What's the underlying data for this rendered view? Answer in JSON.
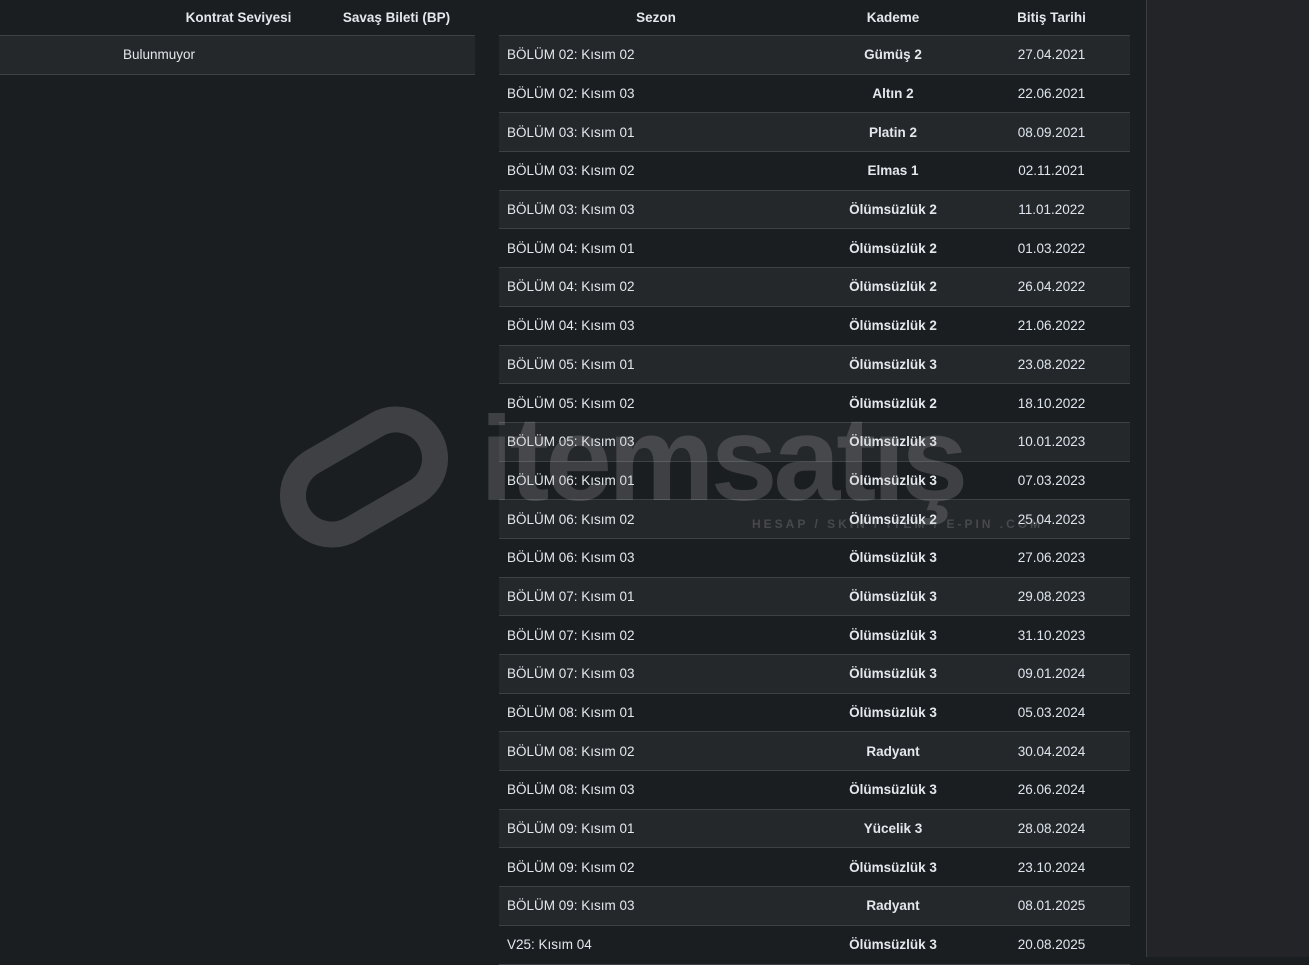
{
  "left_table": {
    "headers": [
      "",
      "Kontrat Seviyesi",
      "Savaş Bileti (BP)"
    ],
    "row": {
      "value": "Bulunmuyor"
    }
  },
  "right_table": {
    "headers": [
      "Sezon",
      "Kademe",
      "Bitiş Tarihi"
    ],
    "rows": [
      [
        "BÖLÜM 02: Kısım 02",
        "Gümüş 2",
        "27.04.2021"
      ],
      [
        "BÖLÜM 02: Kısım 03",
        "Altın 2",
        "22.06.2021"
      ],
      [
        "BÖLÜM 03: Kısım 01",
        "Platin 2",
        "08.09.2021"
      ],
      [
        "BÖLÜM 03: Kısım 02",
        "Elmas 1",
        "02.11.2021"
      ],
      [
        "BÖLÜM 03: Kısım 03",
        "Ölümsüzlük 2",
        "11.01.2022"
      ],
      [
        "BÖLÜM 04: Kısım 01",
        "Ölümsüzlük 2",
        "01.03.2022"
      ],
      [
        "BÖLÜM 04: Kısım 02",
        "Ölümsüzlük 2",
        "26.04.2022"
      ],
      [
        "BÖLÜM 04: Kısım 03",
        "Ölümsüzlük 2",
        "21.06.2022"
      ],
      [
        "BÖLÜM 05: Kısım 01",
        "Ölümsüzlük 3",
        "23.08.2022"
      ],
      [
        "BÖLÜM 05: Kısım 02",
        "Ölümsüzlük 2",
        "18.10.2022"
      ],
      [
        "BÖLÜM 05: Kısım 03",
        "Ölümsüzlük 3",
        "10.01.2023"
      ],
      [
        "BÖLÜM 06: Kısım 01",
        "Ölümsüzlük 3",
        "07.03.2023"
      ],
      [
        "BÖLÜM 06: Kısım 02",
        "Ölümsüzlük 2",
        "25.04.2023"
      ],
      [
        "BÖLÜM 06: Kısım 03",
        "Ölümsüzlük 3",
        "27.06.2023"
      ],
      [
        "BÖLÜM 07: Kısım 01",
        "Ölümsüzlük 3",
        "29.08.2023"
      ],
      [
        "BÖLÜM 07: Kısım 02",
        "Ölümsüzlük 3",
        "31.10.2023"
      ],
      [
        "BÖLÜM 07: Kısım 03",
        "Ölümsüzlük 3",
        "09.01.2024"
      ],
      [
        "BÖLÜM 08: Kısım 01",
        "Ölümsüzlük 3",
        "05.03.2024"
      ],
      [
        "BÖLÜM 08: Kısım 02",
        "Radyant",
        "30.04.2024"
      ],
      [
        "BÖLÜM 08: Kısım 03",
        "Ölümsüzlük 3",
        "26.06.2024"
      ],
      [
        "BÖLÜM 09: Kısım 01",
        "Yücelik 3",
        "28.08.2024"
      ],
      [
        "BÖLÜM 09: Kısım 02",
        "Ölümsüzlük 3",
        "23.10.2024"
      ],
      [
        "BÖLÜM 09: Kısım 03",
        "Radyant",
        "08.01.2025"
      ],
      [
        "V25: Kısım 04",
        "Ölümsüzlük 3",
        "20.08.2025"
      ]
    ]
  },
  "watermark": {
    "brand": "itemsatış",
    "tagline": "HESAP / SKIN / ITEM / E-PIN .COM"
  }
}
